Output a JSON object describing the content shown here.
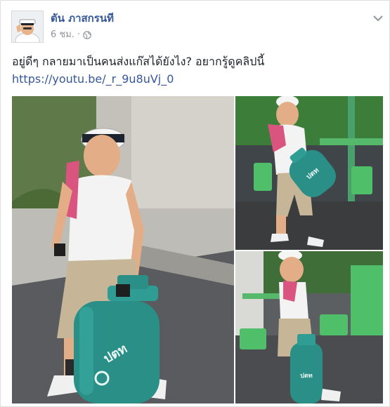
{
  "post": {
    "author_name": "ตัน ภาสกรนที",
    "time": "6 ชม.",
    "dot": "·",
    "privacy_icon": "globe-icon",
    "menu_icon": "chevron-down-icon",
    "text": "อยู่ดีๆ กลายมาเป็นคนส่งแก๊สได้ยังไง? อยากรู้ดูคลิปนี้",
    "link": "https://youtu.be/_r_9u8uVj_0"
  },
  "photos": [
    {
      "label": "ปตท"
    },
    {
      "label": "ปตท"
    },
    {
      "label": "ปตท"
    }
  ],
  "colors": {
    "author": "#365899",
    "meta": "#90949c",
    "text": "#1d2129",
    "link": "#365899",
    "tank": "#2a8f86",
    "towel": "#d9557f"
  }
}
